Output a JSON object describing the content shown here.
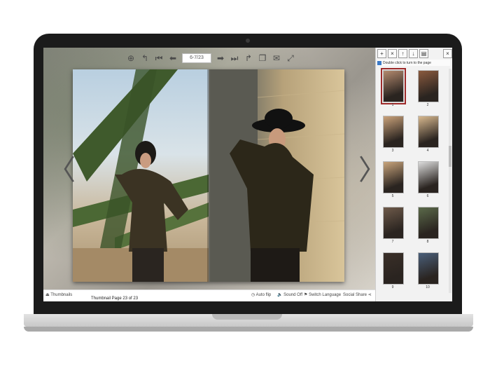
{
  "toolbar": {
    "icons": [
      "zoom-in-icon",
      "undo-icon",
      "first-page-icon",
      "prev-page-icon",
      "next-page-icon",
      "last-page-icon",
      "redo-icon",
      "copy-icon",
      "mail-icon",
      "fullscreen-icon"
    ],
    "page_field": "6-7/23"
  },
  "viewer": {
    "nav_left": "〈",
    "nav_right": "〉"
  },
  "bottom_bar": {
    "thumbnails": "Thumbnails",
    "auto_flip": "Auto flip",
    "sound": "Sound Off",
    "language": "Switch Language",
    "social_share": "Social Share",
    "caption": "Thumbnail Page 23 of 23"
  },
  "sidebar": {
    "buttons": [
      "+",
      "×",
      "↑",
      "↓",
      "▤"
    ],
    "close": "×",
    "hint": "Double click to turn to the page",
    "thumbnails": [
      {
        "label": "1",
        "color": "#b48a6e"
      },
      {
        "label": "2",
        "color": "#8a5a3e"
      },
      {
        "label": "3",
        "color": "#caa27a"
      },
      {
        "label": "4",
        "color": "#d8b98f"
      },
      {
        "label": "5",
        "color": "#c9a57c"
      },
      {
        "label": "6",
        "color": "#dcdcdc"
      },
      {
        "label": "7",
        "color": "#6e5a4a"
      },
      {
        "label": "8",
        "color": "#5b6a4a"
      },
      {
        "label": "9",
        "color": "#3a2f28"
      },
      {
        "label": "10",
        "color": "#4a5f7a"
      }
    ]
  }
}
